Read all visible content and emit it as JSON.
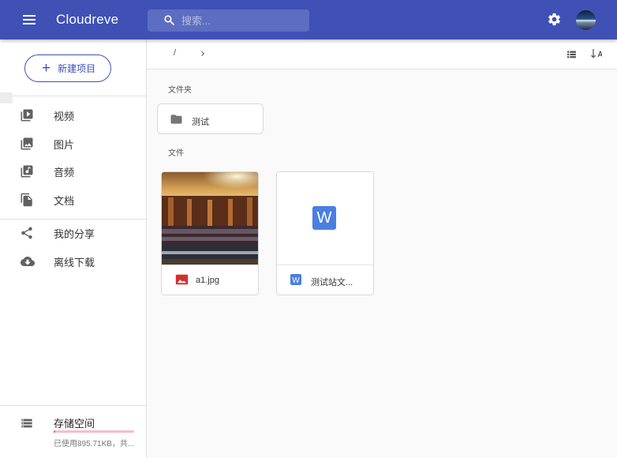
{
  "app": {
    "title": "Cloudreve"
  },
  "search": {
    "placeholder": "搜索..."
  },
  "sidebar": {
    "new_button": "新建项目",
    "items": [
      {
        "label": "视频",
        "icon": "video-icon"
      },
      {
        "label": "图片",
        "icon": "image-icon"
      },
      {
        "label": "音频",
        "icon": "audio-icon"
      },
      {
        "label": "文档",
        "icon": "document-icon"
      },
      {
        "label": "我的分享",
        "icon": "share-icon"
      },
      {
        "label": "离线下载",
        "icon": "cloud-download-icon"
      }
    ],
    "storage": {
      "label": "存储空间",
      "info": "已使用895.71KB，共...",
      "used_fraction": 0.02
    }
  },
  "toolbar": {
    "crumb_sep": "/"
  },
  "content": {
    "folders_title": "文件夹",
    "files_title": "文件",
    "folders": [
      {
        "name": "测试"
      }
    ],
    "files": [
      {
        "name": "a1.jpg",
        "type": "image"
      },
      {
        "name": "测试站文...",
        "type": "word",
        "badge": "W"
      }
    ]
  },
  "colors": {
    "primary": "#3f51b5",
    "storage_bar": "#ef5b8a",
    "word_blue": "#4a7fe0",
    "image_red": "#d32f2f"
  }
}
